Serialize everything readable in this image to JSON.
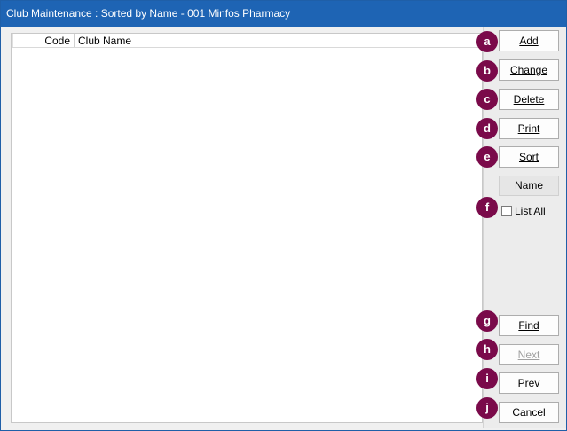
{
  "window": {
    "title": "Club Maintenance : Sorted by Name - 001 Minfos Pharmacy"
  },
  "grid": {
    "columns": [
      "Code",
      "Club Name"
    ],
    "rows": []
  },
  "buttons": {
    "add": "Add",
    "change": "Change",
    "delete": "Delete",
    "print": "Print",
    "sort": "Sort",
    "find": "Find",
    "next": "Next",
    "prev": "Prev",
    "cancel": "Cancel"
  },
  "sort_value": "Name",
  "list_all": {
    "label": "List All",
    "checked": false
  },
  "badges": [
    "a",
    "b",
    "c",
    "d",
    "e",
    "f",
    "g",
    "h",
    "i",
    "j"
  ],
  "colors": {
    "titlebar": "#1e64b4",
    "badge": "#7a0a4a"
  }
}
